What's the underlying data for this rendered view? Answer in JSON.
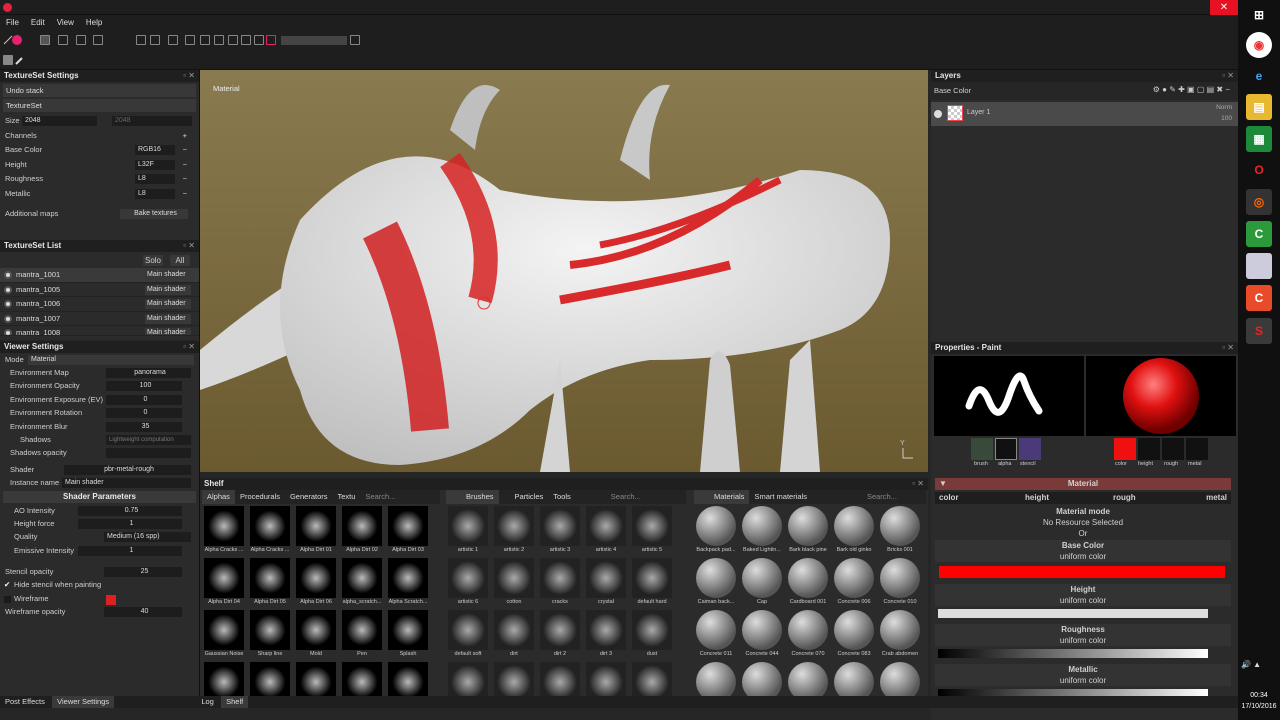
{
  "app": {
    "menu": [
      "File",
      "Edit",
      "View",
      "Help"
    ]
  },
  "textureset_settings": {
    "title": "TextureSet Settings",
    "undo": "Undo stack",
    "textureset": "TextureSet",
    "size_label": "Size",
    "size_value": "2048",
    "size_value2": "2048",
    "channels_label": "Channels",
    "channels": [
      {
        "name": "Base Color",
        "fmt": "RGB16"
      },
      {
        "name": "Height",
        "fmt": "L32F"
      },
      {
        "name": "Roughness",
        "fmt": "L8"
      },
      {
        "name": "Metallic",
        "fmt": "L8"
      }
    ],
    "additional_maps": "Additional maps",
    "bake": "Bake textures"
  },
  "textureset_list": {
    "title": "TextureSet List",
    "solo": "Solo",
    "all": "All",
    "items": [
      "mantra_1001",
      "mantra_1005",
      "mantra_1006",
      "mantra_1007",
      "mantra_1008"
    ],
    "shader": "Main shader"
  },
  "viewer": {
    "title": "Viewer Settings",
    "mode_label": "Mode",
    "mode_value": "Material",
    "params": [
      {
        "label": "Environment Map",
        "value": "panorama"
      },
      {
        "label": "Environment Opacity",
        "value": "100"
      },
      {
        "label": "Environment Exposure (EV)",
        "value": "0"
      },
      {
        "label": "Environment Rotation",
        "value": "0"
      },
      {
        "label": "Environment Blur",
        "value": "35"
      }
    ],
    "shadows": "Shadows",
    "shadows_value": "Lightweight computation",
    "shadows_opacity": "Shadows opacity",
    "shader_label": "Shader",
    "shader_value": "pbr-metal-rough",
    "instance_label": "Instance name",
    "instance_value": "Main shader",
    "shader_params": "Shader Parameters",
    "sp": [
      {
        "label": "AO Intensity",
        "value": "0.75"
      },
      {
        "label": "Height force",
        "value": "1"
      },
      {
        "label": "Quality",
        "value": "Medium (16 spp)"
      },
      {
        "label": "Emissive Intensity",
        "value": "1"
      }
    ],
    "stencil_opacity": "Stencil opacity",
    "stencil_value": "25",
    "hide_stencil": "Hide stencil when painting",
    "wireframe": "Wireframe",
    "wire_opacity": "Wireframe opacity",
    "wire_value": "40"
  },
  "viewport": {
    "label": "Material"
  },
  "shelf": {
    "title": "Shelf",
    "tabs1": [
      "Alphas",
      "Procedurals",
      "Generators",
      "Textu"
    ],
    "search": "Search...",
    "alphas": [
      "Alpha Cracks ...",
      "Alpha Cracks ...",
      "Alpha Dirt 01",
      "Alpha Dirt 02",
      "Alpha Dirt 03",
      "Alpha Dirt 04",
      "Alpha Dirt 05",
      "Alpha Dirt 06",
      "alpha_scratch...",
      "Alpha Scratch...",
      "Gaussian Noise",
      "Sharp line",
      "Mold",
      "Pen",
      "Splash",
      "",
      "",
      "",
      "",
      ""
    ],
    "tabs2": [
      "Brushes",
      "Particles",
      "Tools"
    ],
    "brushes": [
      "artistic 1",
      "artistic 2",
      "artistic 3",
      "artistic 4",
      "artistic 5",
      "artistic 6",
      "cotton",
      "cracks",
      "crystal",
      "default hard",
      "default soft",
      "dirt",
      "dirt 2",
      "dirt 3",
      "dust",
      "",
      "",
      "",
      "",
      ""
    ],
    "tabs3": [
      "Materials",
      "Smart materials"
    ],
    "materials": [
      "Backpack pad...",
      "Baked Lightin...",
      "Bark black pine",
      "Bark old ginko",
      "Bricks 001",
      "Caiman back...",
      "Cap",
      "Cardboard 001",
      "Concrete 006",
      "Concrete 010",
      "Concrete 011",
      "Concrete 044",
      "Concrete 070",
      "Concrete 083",
      "Crab abdomen",
      "",
      "",
      "",
      "",
      ""
    ]
  },
  "status": {
    "tabs": [
      "Post Effects",
      "Viewer Settings"
    ],
    "tabs2": [
      "Log",
      "Shelf"
    ]
  },
  "layers": {
    "title": "Layers",
    "channel": "Base Color",
    "layer_name": "Layer 1",
    "blend": "Norm",
    "opacity": "100"
  },
  "props": {
    "title": "Properties - Paint",
    "icons": [
      "brush",
      "alpha",
      "stencil"
    ],
    "icons2": [
      "color",
      "height",
      "rough",
      "metal"
    ],
    "material": "Material",
    "mat_tabs": [
      "color",
      "height",
      "rough",
      "metal"
    ],
    "mat_mode": "Material mode",
    "no_res": "No Resource Selected",
    "or": "Or",
    "base_color": "Base Color",
    "uniform": "uniform color",
    "height": "Height",
    "roughness": "Roughness",
    "metallic": "Metallic"
  },
  "taskbar": {
    "time": "00:34",
    "date": "17/10/2016"
  }
}
